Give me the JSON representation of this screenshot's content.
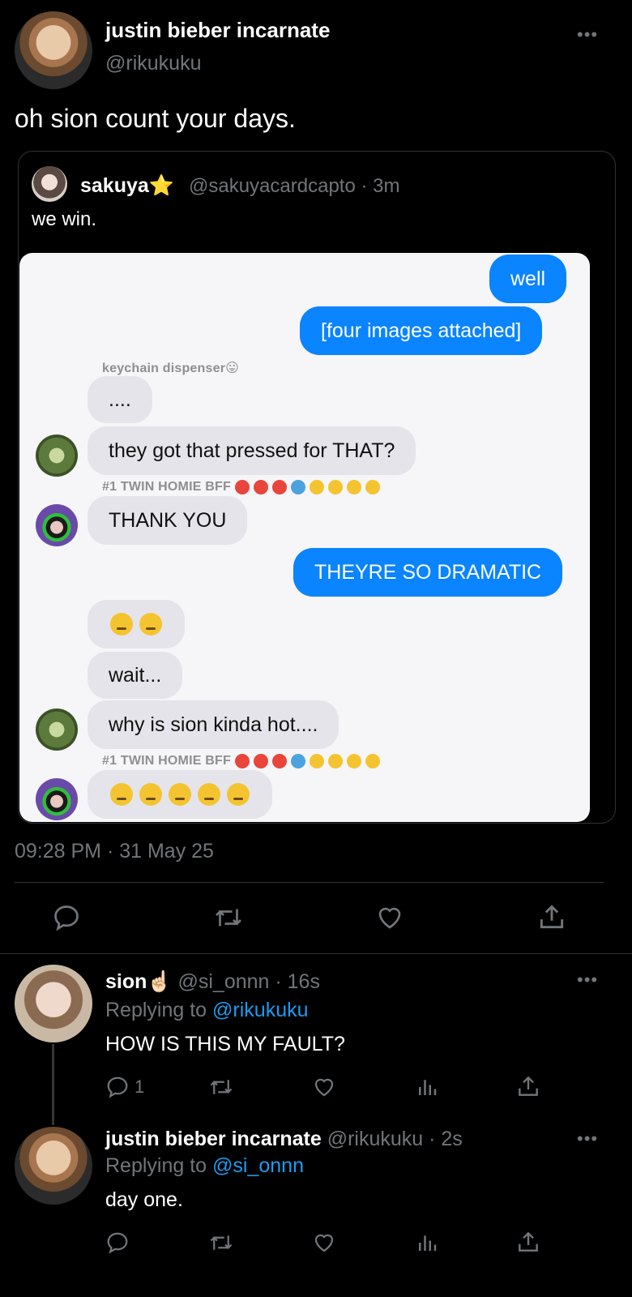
{
  "main_tweet": {
    "display_name": "justin bieber incarnate",
    "handle": "@rikukuku",
    "text": "oh sion count your days.",
    "timestamp": "09:28 PM · 31 May 25"
  },
  "quoted": {
    "display_name": "sakuya⭐",
    "handle_time": "@sakuyacardcapto · 3m",
    "text": "we win."
  },
  "chat": {
    "out1": "well",
    "out2": "[four images attached]",
    "sender1": "keychain dispenser😛",
    "in1": "....",
    "in2": "they got that pressed for THAT?",
    "sender2": "#1 TWIN HOMIE BFF",
    "in3": "THANK YOU",
    "out3": "THEYRE SO DRAMATIC",
    "in4_emoji_count": 2,
    "in5": "wait...",
    "in6": "why is sion kinda hot....",
    "sender3": "#1 TWIN HOMIE BFF",
    "in7_emoji_count": 5,
    "reaction_colors": [
      "#e8453c",
      "#e8453c",
      "#e8453c",
      "#4aa3df",
      "#f4c430",
      "#f4c430",
      "#f4c430",
      "#f4c430"
    ]
  },
  "reply1": {
    "display_name": "sion☝🏻",
    "handle_time": "@si_onnn · 16s",
    "replying_prefix": "Replying to",
    "replying_to": "@rikukuku",
    "text": "HOW IS THIS MY FAULT?",
    "reply_count": "1"
  },
  "reply2": {
    "display_name": "justin bieber incarnate",
    "handle_time": "@rikukuku · 2s",
    "replying_prefix": "Replying to",
    "replying_to": "@si_onnn",
    "text": "day one."
  },
  "icons": {
    "reply": "reply-icon",
    "retweet": "retweet-icon",
    "like": "heart-icon",
    "share": "share-icon",
    "analytics": "analytics-icon",
    "more": "more-icon"
  },
  "colors": {
    "background": "#000000",
    "link": "#1d9bf0",
    "muted": "#71767b",
    "imessage_blue": "#0a84ff",
    "imessage_gray": "#e5e4ea"
  }
}
